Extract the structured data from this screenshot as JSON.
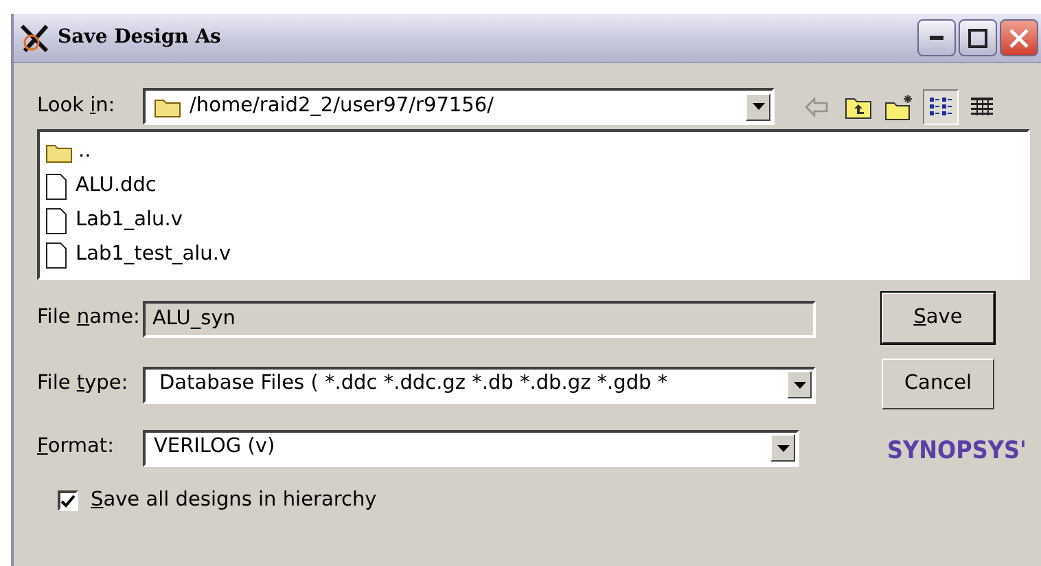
{
  "window": {
    "title": "Save Design As"
  },
  "look_in": {
    "label": {
      "pre": "Look ",
      "key": "i",
      "post": "n:"
    },
    "path": "/home/raid2_2/user97/r97156/"
  },
  "toolbar": [
    {
      "kind": "back",
      "disabled": true,
      "selected": false
    },
    {
      "kind": "up",
      "disabled": false,
      "selected": false
    },
    {
      "kind": "new_folder",
      "disabled": false,
      "selected": false
    },
    {
      "kind": "list_view",
      "disabled": false,
      "selected": true
    },
    {
      "kind": "detail_view",
      "disabled": false,
      "selected": false
    }
  ],
  "files": [
    {
      "kind": "folder",
      "name": ".."
    },
    {
      "kind": "file",
      "name": "ALU.ddc"
    },
    {
      "kind": "file",
      "name": "Lab1_alu.v"
    },
    {
      "kind": "file",
      "name": "Lab1_test_alu.v"
    }
  ],
  "file_name": {
    "label": {
      "pre": "File ",
      "key": "n",
      "post": "ame:"
    },
    "value": "ALU_syn"
  },
  "file_type": {
    "label": {
      "pre": "File ",
      "key": "t",
      "post": "ype:"
    },
    "value": "Database Files ( *.ddc *.ddc.gz *.db *.db.gz *.gdb *"
  },
  "format": {
    "label": {
      "key": "F",
      "post": "ormat:"
    },
    "value": "VERILOG (v)"
  },
  "buttons": [
    {
      "label": {
        "key": "S",
        "post": "ave"
      },
      "default": true
    },
    {
      "label": {
        "pre": "Cancel"
      },
      "default": false
    }
  ],
  "logo": "SYNOPSYS'",
  "hierarchy_option": {
    "label": {
      "key": "S",
      "post": "ave all designs in hierarchy"
    },
    "checked": true
  }
}
